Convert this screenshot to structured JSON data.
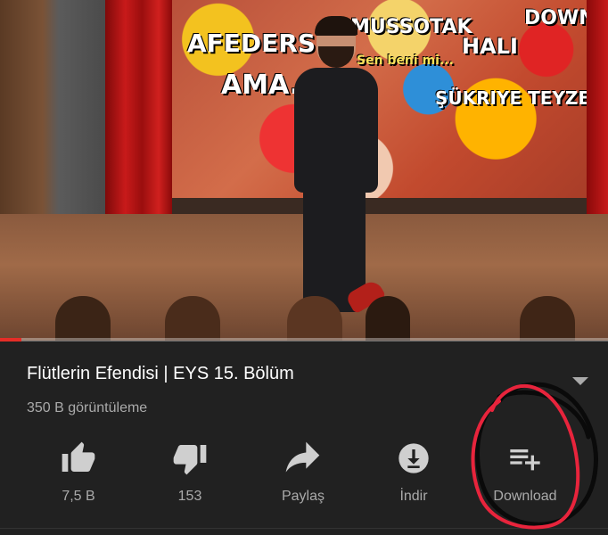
{
  "video": {
    "progress_fraction": 0.035,
    "wall_text": [
      "AFEDERSİN",
      "AMA...",
      "MUSSOTAK",
      "HALI",
      "ŞÜKRIYE TEYZE",
      "DOWN",
      "Sen beni mi..."
    ]
  },
  "info": {
    "title": "Flütlerin Efendisi | EYS 15. Bölüm",
    "views": "350 B görüntüleme"
  },
  "actions": {
    "like": "7,5 B",
    "dislike": "153",
    "share": "Paylaş",
    "download": "İndir",
    "save": "Download"
  },
  "colors": {
    "background": "#212121",
    "text": "#ffffff",
    "muted": "#aaaaaa",
    "progress": "#e52d27",
    "annotation": "#e8243c"
  }
}
